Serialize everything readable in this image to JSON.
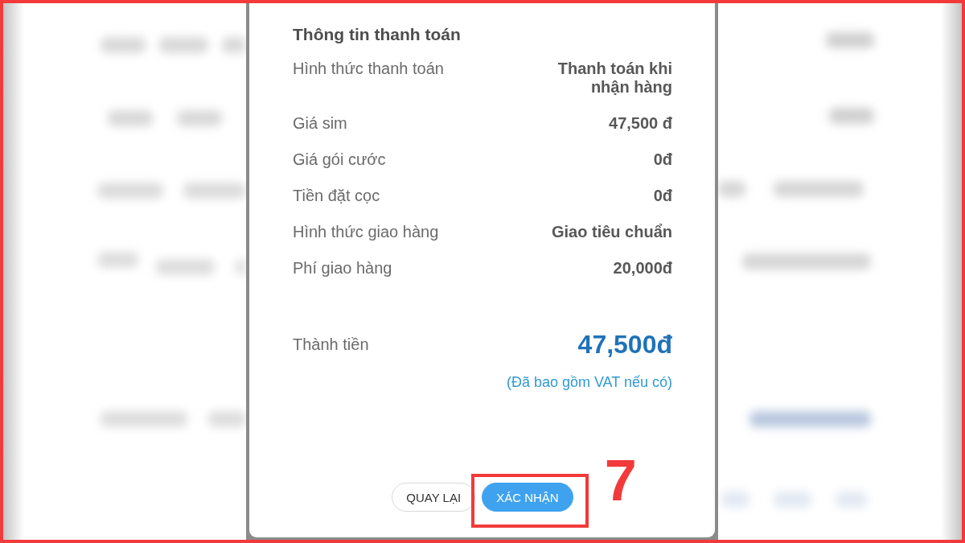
{
  "payment_info": {
    "title": "Thông tin thanh toán",
    "rows": [
      {
        "label": "Hình thức thanh toán",
        "value": "Thanh toán khi nhận hàng"
      },
      {
        "label": "Giá sim",
        "value": "47,500 đ"
      },
      {
        "label": "Giá gói cước",
        "value": "0đ"
      },
      {
        "label": "Tiền đặt cọc",
        "value": "0đ"
      },
      {
        "label": "Hình thức giao hàng",
        "value": "Giao tiêu chuẩn"
      },
      {
        "label": "Phí giao hàng",
        "value": "20,000đ"
      }
    ],
    "total": {
      "label": "Thành tiền",
      "value": "47,500đ",
      "note": "(Đã bao gồm VAT nếu có)"
    },
    "buttons": [
      {
        "label": "QUAY LẠI",
        "kind": "secondary",
        "highlighted": false
      },
      {
        "label": "XÁC NHẬN",
        "kind": "primary",
        "highlighted": true
      }
    ]
  },
  "annotation": {
    "step_label": "7"
  }
}
